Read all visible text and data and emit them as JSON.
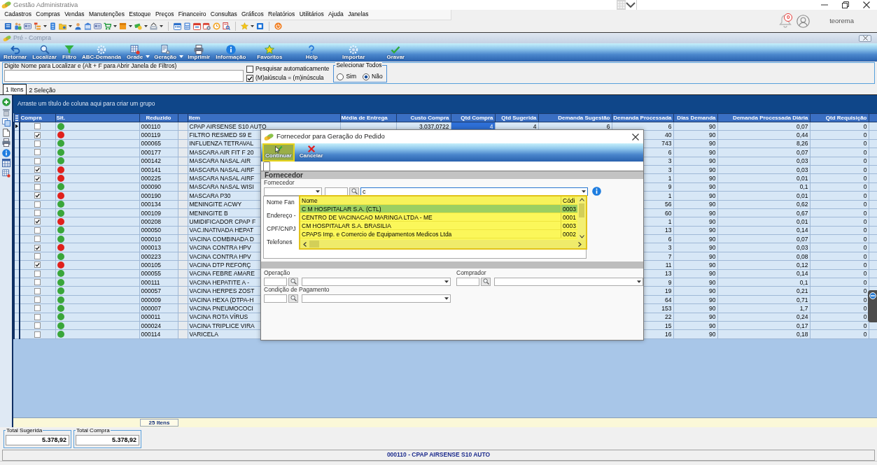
{
  "window": {
    "title": "Gestão Administrativa"
  },
  "menu": [
    "Cadastros",
    "Compras",
    "Vendas",
    "Manutenções",
    "Estoque",
    "Preços",
    "Financeiro",
    "Consultas",
    "Gráficos",
    "Relatórios",
    "Utilitários",
    "Ajuda",
    "Janelas"
  ],
  "user": {
    "notifications": "0",
    "name": "teorema"
  },
  "document": {
    "title": "Pré - Compra",
    "toolbar": [
      {
        "label": "Retornar",
        "dropdown": false
      },
      {
        "label": "Localizar",
        "dropdown": false
      },
      {
        "label": "Filtro",
        "dropdown": false
      },
      {
        "label": "ABC-Demanda",
        "dropdown": false
      },
      {
        "label": "Grade",
        "dropdown": true
      },
      {
        "label": "Geração",
        "dropdown": true
      },
      {
        "label": "Imprimir",
        "dropdown": false
      },
      {
        "label": "Informação",
        "dropdown": false
      },
      {
        "label": "Favoritos",
        "dropdown": false
      },
      {
        "label": "Help",
        "dropdown": false
      },
      {
        "label": "Importar",
        "dropdown": false
      },
      {
        "label": "Gravar",
        "dropdown": false
      }
    ],
    "search": {
      "label": "Digite Nome para Localizar e (Alt + F para Abrir Janela de Filtros)"
    },
    "options": [
      {
        "label": "Pesquisar automaticamente",
        "checked": false
      },
      {
        "label": "(M)aiúscula = (m)inúscula",
        "checked": true
      }
    ],
    "select_all": {
      "title": "Selecionar Todos",
      "options": [
        {
          "label": "Sim",
          "selected": false
        },
        {
          "label": "Não",
          "selected": true
        }
      ]
    },
    "tabs": [
      {
        "label": "1 Itens",
        "selected": true
      },
      {
        "label": "2 Seleção",
        "selected": false
      }
    ],
    "grid": {
      "group_hint": "Arraste um título de coluna aqui para criar um grupo",
      "columns": [
        "Compra",
        "Sit.",
        "Reduzido",
        "Item",
        "Média de Entrega",
        "Custo Compra",
        "Qtd Compra",
        "Qtd Sugerida",
        "Demanda Sugestão",
        "Demanda Processada",
        "Dias Demanda",
        "Demanda Processada Diária",
        "Qtd Requisição"
      ],
      "rows": [
        {
          "selected": true,
          "checked": false,
          "color": "#3aa63a",
          "reduzido": "000110",
          "item": "CPAP AIRSENSE S10 AUTO",
          "custo_compra": "3.037,0722",
          "qtd_compra": "4",
          "qtd_sugerida": "4",
          "demanda_sugestao": "6",
          "demanda_processada": "6",
          "dias_demanda": "90",
          "demanda_processada_diaria": "0,07",
          "qtd_requisicao": "0"
        },
        {
          "selected": false,
          "checked": true,
          "color": "#e0201c",
          "reduzido": "000119",
          "item": "FILTRO RESMED S9 E",
          "demanda_processada": "40",
          "dias_demanda": "90",
          "demanda_processada_diaria": "0,44",
          "qtd_requisicao": "0"
        },
        {
          "selected": false,
          "checked": false,
          "color": "#3aa63a",
          "reduzido": "000065",
          "item": "INFLUENZA TETRAVAL",
          "demanda_processada": "743",
          "dias_demanda": "90",
          "demanda_processada_diaria": "8,26",
          "qtd_requisicao": "0"
        },
        {
          "selected": false,
          "checked": false,
          "color": "#3aa63a",
          "reduzido": "000177",
          "item": "MASCARA AIR FIT F 20",
          "demanda_processada": "6",
          "dias_demanda": "90",
          "demanda_processada_diaria": "0,07",
          "qtd_requisicao": "0"
        },
        {
          "selected": false,
          "checked": false,
          "color": "#3aa63a",
          "reduzido": "000142",
          "item": "MASCARA NASAL AIR",
          "demanda_processada": "3",
          "dias_demanda": "90",
          "demanda_processada_diaria": "0,03",
          "qtd_requisicao": "0"
        },
        {
          "selected": false,
          "checked": true,
          "color": "#e0201c",
          "reduzido": "000141",
          "item": "MASCARA NASAL AIRF",
          "demanda_processada": "3",
          "dias_demanda": "90",
          "demanda_processada_diaria": "0,03",
          "qtd_requisicao": "0"
        },
        {
          "selected": false,
          "checked": true,
          "color": "#e0201c",
          "reduzido": "000225",
          "item": "MASCARA NASAL AIRF",
          "demanda_processada": "1",
          "dias_demanda": "90",
          "demanda_processada_diaria": "0,01",
          "qtd_requisicao": "0"
        },
        {
          "selected": false,
          "checked": false,
          "color": "#3aa63a",
          "reduzido": "000090",
          "item": "MASCARA NASAL WISI",
          "demanda_processada": "9",
          "dias_demanda": "90",
          "demanda_processada_diaria": "0,1",
          "qtd_requisicao": "0"
        },
        {
          "selected": false,
          "checked": true,
          "color": "#e0201c",
          "reduzido": "000190",
          "item": "MASCARA P30",
          "demanda_processada": "1",
          "dias_demanda": "90",
          "demanda_processada_diaria": "0,01",
          "qtd_requisicao": "0"
        },
        {
          "selected": false,
          "checked": false,
          "color": "#3aa63a",
          "reduzido": "000134",
          "item": "MENINGITE ACWY",
          "demanda_processada": "56",
          "dias_demanda": "90",
          "demanda_processada_diaria": "0,62",
          "qtd_requisicao": "0"
        },
        {
          "selected": false,
          "checked": false,
          "color": "#3aa63a",
          "reduzido": "000109",
          "item": "MENINGITE B",
          "demanda_processada": "60",
          "dias_demanda": "90",
          "demanda_processada_diaria": "0,67",
          "qtd_requisicao": "0"
        },
        {
          "selected": false,
          "checked": true,
          "color": "#e0201c",
          "reduzido": "000208",
          "item": "UMIDIFICADOR CPAP F",
          "demanda_processada": "1",
          "dias_demanda": "90",
          "demanda_processada_diaria": "0,01",
          "qtd_requisicao": "0"
        },
        {
          "selected": false,
          "checked": false,
          "color": "#3aa63a",
          "reduzido": "000050",
          "item": "VAC.INATIVADA HEPAT",
          "demanda_processada": "13",
          "dias_demanda": "90",
          "demanda_processada_diaria": "0,14",
          "qtd_requisicao": "0"
        },
        {
          "selected": false,
          "checked": false,
          "color": "#3aa63a",
          "reduzido": "000010",
          "item": "VACINA COMBINADA D",
          "demanda_processada": "6",
          "dias_demanda": "90",
          "demanda_processada_diaria": "0,07",
          "qtd_requisicao": "0"
        },
        {
          "selected": false,
          "checked": true,
          "color": "#e0201c",
          "reduzido": "000013",
          "item": "VACINA CONTRA HPV",
          "demanda_processada": "3",
          "dias_demanda": "90",
          "demanda_processada_diaria": "0,03",
          "qtd_requisicao": "0"
        },
        {
          "selected": false,
          "checked": false,
          "color": "#3aa63a",
          "reduzido": "000223",
          "item": "VACINA CONTRA HPV",
          "demanda_processada": "7",
          "dias_demanda": "90",
          "demanda_processada_diaria": "0,08",
          "qtd_requisicao": "0"
        },
        {
          "selected": false,
          "checked": true,
          "color": "#e0201c",
          "reduzido": "000105",
          "item": "VACINA DTP REFORÇ",
          "demanda_processada": "11",
          "dias_demanda": "90",
          "demanda_processada_diaria": "0,12",
          "qtd_requisicao": "0"
        },
        {
          "selected": false,
          "checked": false,
          "color": "#3aa63a",
          "reduzido": "000055",
          "item": "VACINA FEBRE AMARE",
          "demanda_processada": "13",
          "dias_demanda": "90",
          "demanda_processada_diaria": "0,14",
          "qtd_requisicao": "0"
        },
        {
          "selected": false,
          "checked": false,
          "color": "#3aa63a",
          "reduzido": "000111",
          "item": "VACINA HEPATITE A -",
          "demanda_processada": "9",
          "dias_demanda": "90",
          "demanda_processada_diaria": "0,1",
          "qtd_requisicao": "0"
        },
        {
          "selected": false,
          "checked": false,
          "color": "#3aa63a",
          "reduzido": "000057",
          "item": "VACINA HERPES ZOST",
          "demanda_processada": "19",
          "dias_demanda": "90",
          "demanda_processada_diaria": "0,21",
          "qtd_requisicao": "0"
        },
        {
          "selected": false,
          "checked": false,
          "color": "#3aa63a",
          "reduzido": "000009",
          "item": "VACINA HEXA (DTPA-H",
          "demanda_processada": "64",
          "dias_demanda": "90",
          "demanda_processada_diaria": "0,71",
          "qtd_requisicao": "0"
        },
        {
          "selected": false,
          "checked": false,
          "color": "#3aa63a",
          "reduzido": "000007",
          "item": "VACINA PNEUMOCOCI",
          "demanda_processada": "153",
          "dias_demanda": "90",
          "demanda_processada_diaria": "1,7",
          "qtd_requisicao": "0"
        },
        {
          "selected": false,
          "checked": false,
          "color": "#3aa63a",
          "reduzido": "000011",
          "item": "VACINA ROTA VÍRUS",
          "demanda_processada": "22",
          "dias_demanda": "90",
          "demanda_processada_diaria": "0,24",
          "qtd_requisicao": "0"
        },
        {
          "selected": false,
          "checked": false,
          "color": "#3aa63a",
          "reduzido": "000024",
          "item": "VACINA TRIPLICE VIRA",
          "demanda_processada": "15",
          "dias_demanda": "90",
          "demanda_processada_diaria": "0,17",
          "qtd_requisicao": "0"
        },
        {
          "selected": false,
          "checked": false,
          "color": "#3aa63a",
          "reduzido": "000114",
          "item": "VARICELA",
          "demanda_processada": "16",
          "dias_demanda": "90",
          "demanda_processada_diaria": "0,18",
          "qtd_requisicao": "0"
        }
      ],
      "footer": "25 Itens"
    },
    "totals": [
      {
        "label": "Total Sugerida",
        "value": "5.378,92"
      },
      {
        "label": "Total Compra",
        "value": "5.378,92"
      }
    ],
    "status_bar": "000110 - CPAP AIRSENSE S10 AUTO"
  },
  "dialog": {
    "title": "Fornecedor para Geração do Pedido",
    "toolbar": [
      {
        "label": "Continuar",
        "highlighted": true
      },
      {
        "label": "Cancelar",
        "highlighted": false
      }
    ],
    "section": "Fornecedor",
    "supplier": {
      "label": "Fornecedor",
      "value": "c"
    },
    "details": [
      "Nome Fan",
      "Endereço -",
      "CPF/CNPJ",
      "Telefones"
    ],
    "suggestions": {
      "columns": [
        "Nome",
        "Códi"
      ],
      "rows": [
        {
          "name": "C M HOSPITALAR S.A. (CTL)",
          "code": "0003",
          "selected": true
        },
        {
          "name": "CENTRO DE VACINACAO MARINGA LTDA - ME",
          "code": "0001",
          "selected": false
        },
        {
          "name": "CM HOSPITALAR S.A. BRASILIA",
          "code": "0003",
          "selected": false
        },
        {
          "name": "CPAPS Imp. e Comercio de Equipamentos Medicos Ltda",
          "code": "0002",
          "selected": false
        }
      ]
    },
    "fields": [
      {
        "label": "Operação"
      },
      {
        "label": "Comprador"
      },
      {
        "label": "Condição de Pagamento"
      }
    ]
  }
}
